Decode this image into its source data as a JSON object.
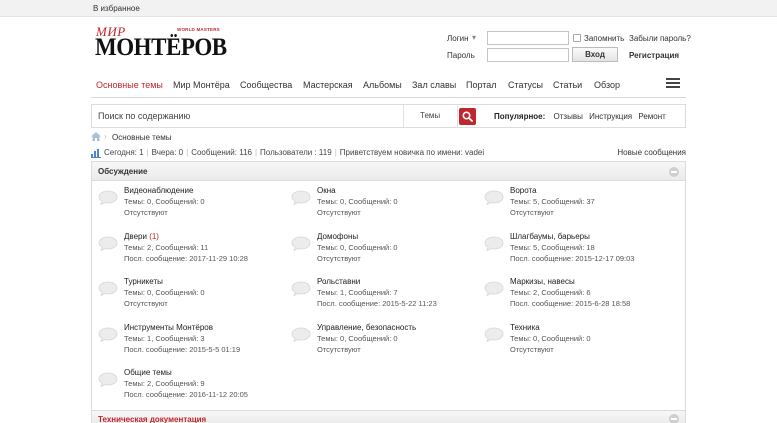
{
  "topbar": {
    "favorites": "В избранное"
  },
  "logo": {
    "mir": "МИР",
    "brand": "МОНТЁРОВ",
    "tagline": "WORLD MASTERS"
  },
  "login": {
    "login_label": "Логин",
    "password_label": "Пароль",
    "login_value": "",
    "password_value": "",
    "remember_label": "Запомнить",
    "forgot_label": "Забыли пароль?",
    "submit_label": "Вход",
    "register_label": "Регистрация"
  },
  "nav": {
    "items": [
      {
        "label": "Основные темы",
        "active": true
      },
      {
        "label": "Мир Монтёра"
      },
      {
        "label": "Сообщества"
      },
      {
        "label": "Мастерская"
      },
      {
        "label": "Альбомы"
      },
      {
        "label": "Зал славы"
      },
      {
        "label": "Портал"
      },
      {
        "label": "Статусы"
      },
      {
        "label": "Статьи"
      },
      {
        "label": "Обзор"
      }
    ]
  },
  "search": {
    "placeholder": "Поиск по содержанию",
    "scope": "Темы",
    "popular_label": "Популярное:",
    "popular_links": [
      "Отзывы",
      "Инструкция",
      "Ремонт"
    ]
  },
  "breadcrumb": {
    "current": "Основные темы"
  },
  "stats": {
    "today": "Сегодня: 1",
    "yesterday": "Вчера: 0",
    "posts": "Сообщений: 116",
    "users": "Пользователи : 119",
    "welcome": "Приветствуем новичка по имени: vadei",
    "new_posts": "Новые сообщения"
  },
  "section": {
    "title": "Обсуждение",
    "forums": [
      {
        "name": "Видеонаблюдение",
        "counts": "Темы: 0, Сообщений: 0",
        "last": "Отсутствуют"
      },
      {
        "name": "Окна",
        "counts": "Темы: 0, Сообщений: 0",
        "last": "Отсутствуют"
      },
      {
        "name": "Ворота",
        "counts": "Темы: 5, Сообщений: 37",
        "last": "Отсутствуют"
      },
      {
        "name": "Двери",
        "badge": "(1)",
        "counts": "Темы: 2, Сообщений: 11",
        "last": "Посл. сообщение: 2017-11-29 10:28"
      },
      {
        "name": "Домофоны",
        "counts": "Темы: 0, Сообщений: 0",
        "last": "Отсутствуют"
      },
      {
        "name": "Шлагбаумы, барьеры",
        "counts": "Темы: 5, Сообщений: 18",
        "last": "Посл. сообщение: 2015-12-17 09:03"
      },
      {
        "name": "Турникеты",
        "counts": "Темы: 0, Сообщений: 0",
        "last": "Отсутствуют"
      },
      {
        "name": "Рольставни",
        "counts": "Темы: 1, Сообщений: 7",
        "last": "Посл. сообщение: 2015-5-22 11:23"
      },
      {
        "name": "Маркизы, навесы",
        "counts": "Темы: 2, Сообщений: 6",
        "last": "Посл. сообщение: 2015-6-28 18:58"
      },
      {
        "name": "Инструменты Монтёров",
        "counts": "Темы: 1, Сообщений: 3",
        "last": "Посл. сообщение: 2015-5-5 01:19"
      },
      {
        "name": "Управление, безопасность",
        "counts": "Темы: 0, Сообщений: 0",
        "last": "Отсутствуют"
      },
      {
        "name": "Техника",
        "counts": "Темы: 0, Сообщений: 0",
        "last": "Отсутствуют"
      },
      {
        "name": "Общие темы",
        "counts": "Темы: 2, Сообщений: 9",
        "last": "Посл. сообщение: 2016-11-12 20:05"
      }
    ]
  },
  "section2": {
    "title": "Техническая документация"
  },
  "colors": {
    "accent": "#c0262d",
    "text": "#333333",
    "border": "#dcdcdc"
  }
}
